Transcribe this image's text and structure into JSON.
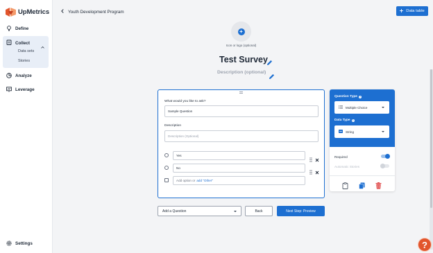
{
  "brand": {
    "name": "UpMetrics",
    "colors": {
      "primary": "#1d6fd1",
      "logo_dark": "#e2552c",
      "logo_light": "#f39a6b",
      "danger": "#e04d4d",
      "help": "#e2552c"
    }
  },
  "sidebar": {
    "items": [
      {
        "label": "Define",
        "icon": "lightbulb-icon"
      },
      {
        "label": "Collect",
        "icon": "clipboard-icon"
      },
      {
        "label": "Analyze",
        "icon": "chart-pie-icon"
      },
      {
        "label": "Leverage",
        "icon": "presentation-icon"
      }
    ],
    "collect_sub": [
      {
        "label": "Data sets"
      },
      {
        "label": "Stories"
      }
    ],
    "settings": {
      "label": "Settings",
      "icon": "gear-icon"
    }
  },
  "header": {
    "back_label": "Youth Development Program",
    "data_table_button": "Data table"
  },
  "survey": {
    "logo_caption": "Icon or logo (optional)",
    "title": "Test Survey",
    "description_placeholder": "Description (optional)"
  },
  "question": {
    "prompt_label": "What would you like to ask?",
    "prompt_value": "Sample Question",
    "description_label": "Description",
    "description_placeholder": "Description (Optional)",
    "options": [
      {
        "label": "Yes"
      },
      {
        "label": "No"
      }
    ],
    "add_option_text": "Add option or",
    "add_other_text": "add \"Other\""
  },
  "settings_panel": {
    "question_type_label": "Question Type",
    "question_type_value": "Multiple Choice",
    "data_type_label": "Data Type",
    "data_type_value": "String",
    "required_label": "Required",
    "required_on": true,
    "automatic_stories_label": "Automatic Stories",
    "automatic_stories_on": false
  },
  "footer": {
    "add_question": "Add a Question",
    "back": "Back",
    "next": "Next Step: Preview"
  },
  "help": {
    "label": "?"
  }
}
